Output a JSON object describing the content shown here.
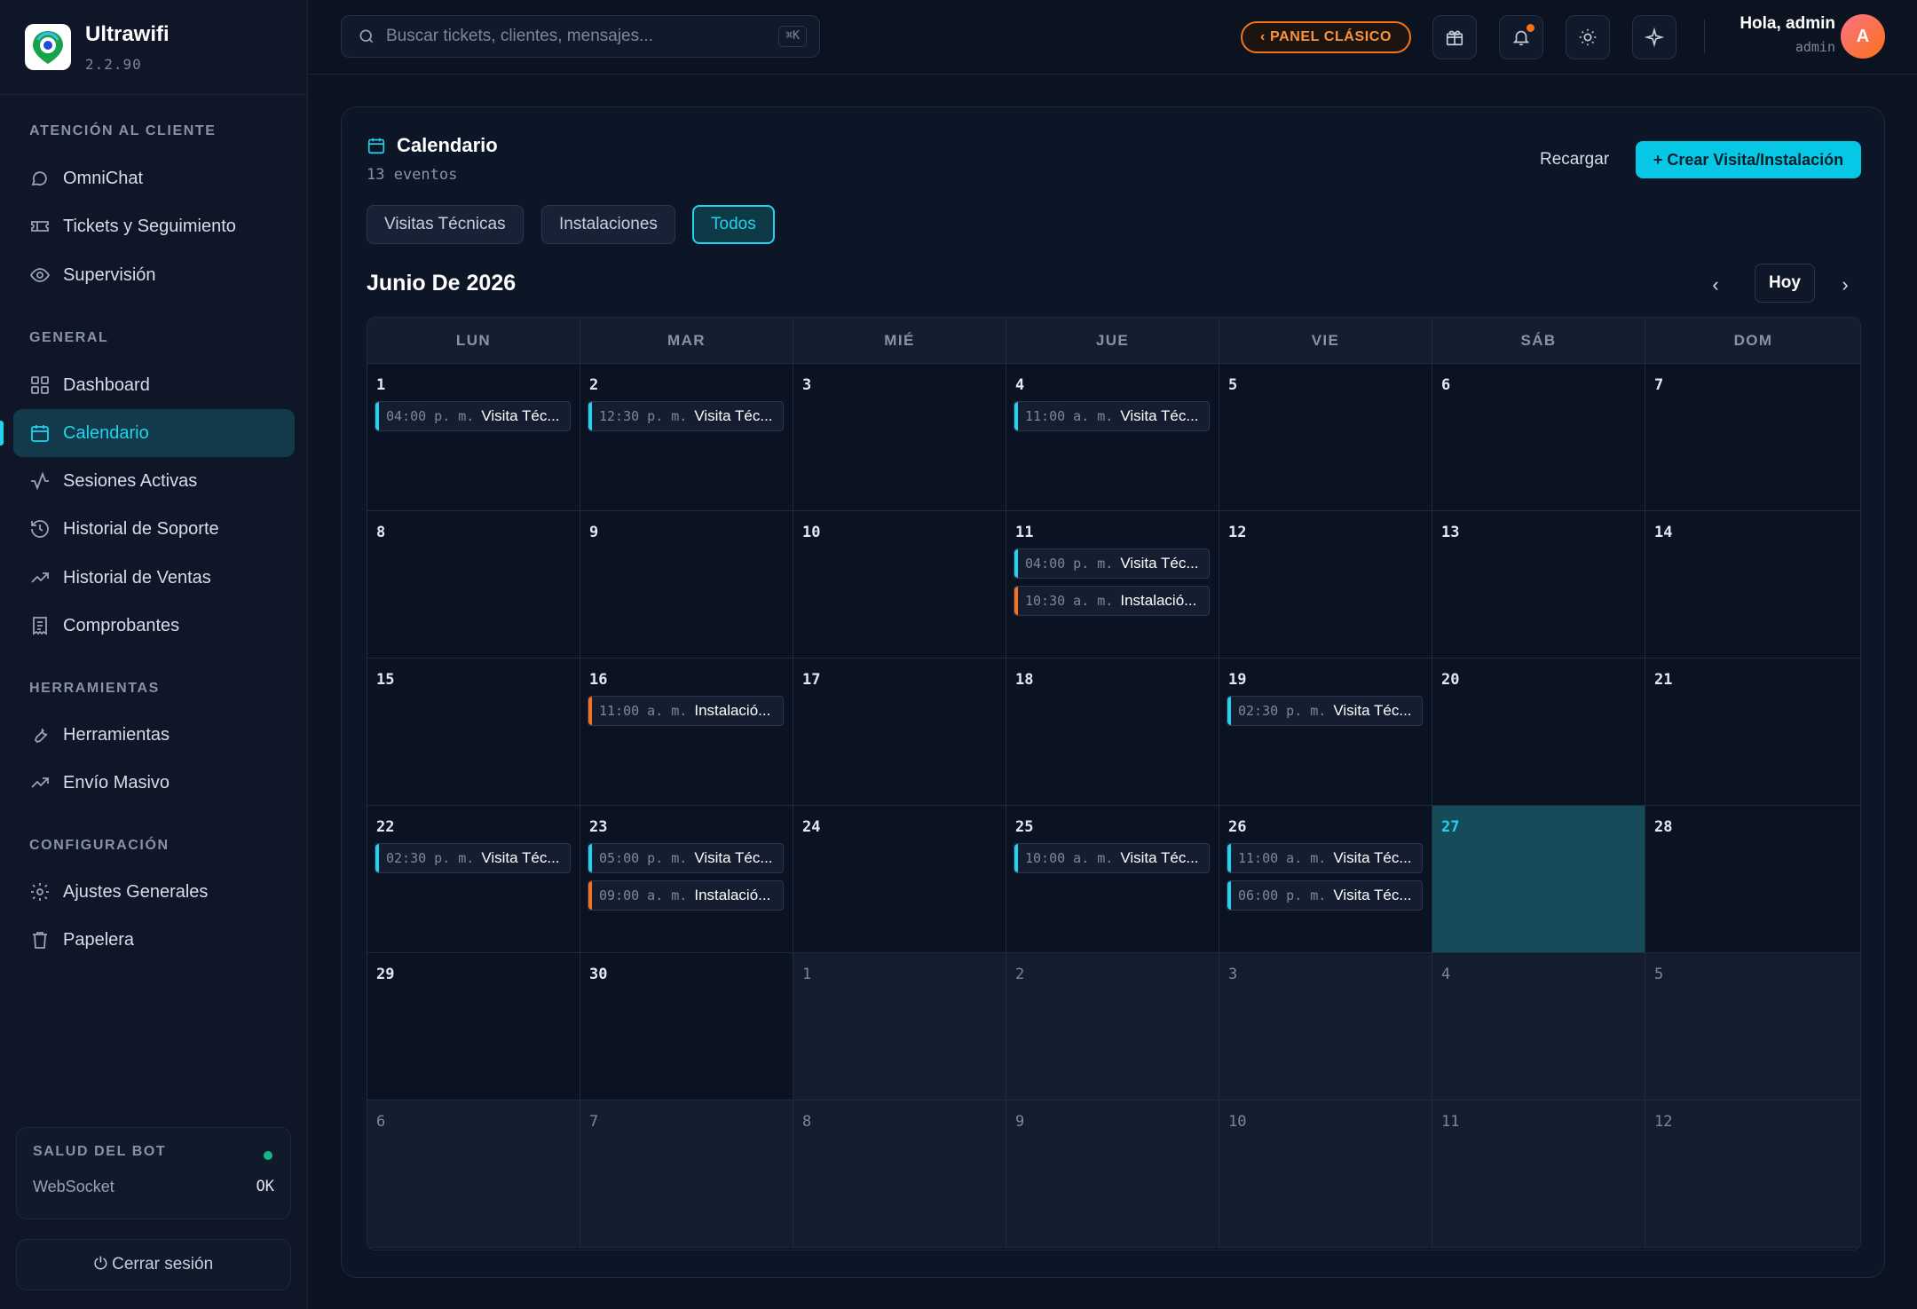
{
  "brand": {
    "name": "Ultrawifi",
    "version": "2.2.90"
  },
  "sidebar": {
    "sections": [
      {
        "heading": "ATENCIÓN AL CLIENTE",
        "items": [
          {
            "label": "OmniChat",
            "icon": "chat-icon"
          },
          {
            "label": "Tickets y Seguimiento",
            "icon": "ticket-icon"
          },
          {
            "label": "Supervisión",
            "icon": "eye-icon"
          }
        ]
      },
      {
        "heading": "GENERAL",
        "items": [
          {
            "label": "Dashboard",
            "icon": "grid-icon"
          },
          {
            "label": "Calendario",
            "icon": "calendar-icon",
            "active": true
          },
          {
            "label": "Sesiones Activas",
            "icon": "activity-icon"
          },
          {
            "label": "Historial de Soporte",
            "icon": "history-icon"
          },
          {
            "label": "Historial de Ventas",
            "icon": "trending-icon"
          },
          {
            "label": "Comprobantes",
            "icon": "receipt-icon"
          }
        ]
      },
      {
        "heading": "HERRAMIENTAS",
        "items": [
          {
            "label": "Herramientas",
            "icon": "wrench-icon"
          },
          {
            "label": "Envío Masivo",
            "icon": "trending-icon"
          }
        ]
      },
      {
        "heading": "CONFIGURACIÓN",
        "items": [
          {
            "label": "Ajustes Generales",
            "icon": "gear-icon"
          },
          {
            "label": "Papelera",
            "icon": "trash-icon"
          }
        ]
      }
    ],
    "bot_health": {
      "title": "SALUD DEL BOT",
      "label": "WebSocket",
      "value": "OK",
      "status_color": "#10b981"
    },
    "logout": "⏻ Cerrar sesión"
  },
  "topbar": {
    "search_placeholder": "Buscar tickets, clientes, mensajes...",
    "search_shortcut": "⌘K",
    "panel_button": "‹  PANEL CLÁSICO",
    "greeting": "Hola, admin",
    "role": "admin",
    "avatar_initial": "A"
  },
  "calendar": {
    "title": "Calendario",
    "subtitle": "13 eventos",
    "reload": "Recargar",
    "create": "+ Crear Visita/Instalación",
    "filters": [
      "Visitas Técnicas",
      "Instalaciones",
      "Todos"
    ],
    "active_filter": 2,
    "month": "Junio De 2026",
    "prev": "‹",
    "today": "Hoy",
    "next": "›",
    "weekdays": [
      "LUN",
      "MAR",
      "MIÉ",
      "JUE",
      "VIE",
      "SÁB",
      "DOM"
    ],
    "weeks": [
      [
        {
          "d": "1"
        },
        {
          "d": "2"
        },
        {
          "d": "3"
        },
        {
          "d": "4"
        },
        {
          "d": "5"
        },
        {
          "d": "6"
        },
        {
          "d": "7"
        }
      ],
      [
        {
          "d": "8"
        },
        {
          "d": "9"
        },
        {
          "d": "10"
        },
        {
          "d": "11"
        },
        {
          "d": "12"
        },
        {
          "d": "13"
        },
        {
          "d": "14"
        }
      ],
      [
        {
          "d": "15"
        },
        {
          "d": "16"
        },
        {
          "d": "17"
        },
        {
          "d": "18"
        },
        {
          "d": "19"
        },
        {
          "d": "20"
        },
        {
          "d": "21"
        }
      ],
      [
        {
          "d": "22"
        },
        {
          "d": "23"
        },
        {
          "d": "24"
        },
        {
          "d": "25"
        },
        {
          "d": "26"
        },
        {
          "d": "27",
          "today": true
        },
        {
          "d": "28"
        }
      ],
      [
        {
          "d": "29"
        },
        {
          "d": "30"
        },
        {
          "d": "1",
          "out": true
        },
        {
          "d": "2",
          "out": true
        },
        {
          "d": "3",
          "out": true
        },
        {
          "d": "4",
          "out": true
        },
        {
          "d": "5",
          "out": true
        }
      ],
      [
        {
          "d": "6",
          "out": true
        },
        {
          "d": "7",
          "out": true
        },
        {
          "d": "8",
          "out": true
        },
        {
          "d": "9",
          "out": true
        },
        {
          "d": "10",
          "out": true
        },
        {
          "d": "11",
          "out": true
        },
        {
          "d": "12",
          "out": true
        }
      ]
    ],
    "events": [
      {
        "week": 0,
        "day": 0,
        "time": "04:00 p. m.",
        "title": "Visita Téc...",
        "type": "visita"
      },
      {
        "week": 0,
        "day": 1,
        "time": "12:30 p. m.",
        "title": "Visita Téc...",
        "type": "visita"
      },
      {
        "week": 0,
        "day": 3,
        "time": "11:00 a. m.",
        "title": "Visita Téc...",
        "type": "visita"
      },
      {
        "week": 1,
        "day": 3,
        "time": "04:00 p. m.",
        "title": "Visita Téc...",
        "type": "visita"
      },
      {
        "week": 1,
        "day": 3,
        "time": "10:30 a. m.",
        "title": "Instalació...",
        "type": "instalacion"
      },
      {
        "week": 2,
        "day": 1,
        "time": "11:00 a. m.",
        "title": "Instalació...",
        "type": "instalacion"
      },
      {
        "week": 2,
        "day": 4,
        "time": "02:30 p. m.",
        "title": "Visita Téc...",
        "type": "visita"
      },
      {
        "week": 3,
        "day": 0,
        "time": "02:30 p. m.",
        "title": "Visita Téc...",
        "type": "visita"
      },
      {
        "week": 3,
        "day": 1,
        "time": "05:00 p. m.",
        "title": "Visita Téc...",
        "type": "visita"
      },
      {
        "week": 3,
        "day": 1,
        "time": "09:00 a. m.",
        "title": "Instalació...",
        "type": "instalacion"
      },
      {
        "week": 3,
        "day": 3,
        "time": "10:00 a. m.",
        "title": "Visita Téc...",
        "type": "visita"
      },
      {
        "week": 3,
        "day": 4,
        "time": "11:00 a. m.",
        "title": "Visita Téc...",
        "type": "visita"
      },
      {
        "week": 3,
        "day": 4,
        "time": "06:00 p. m.",
        "title": "Visita Téc...",
        "type": "visita"
      }
    ]
  },
  "colors": {
    "accent": "#22d3ee",
    "installation": "#f97316",
    "background": "#0b1220"
  }
}
